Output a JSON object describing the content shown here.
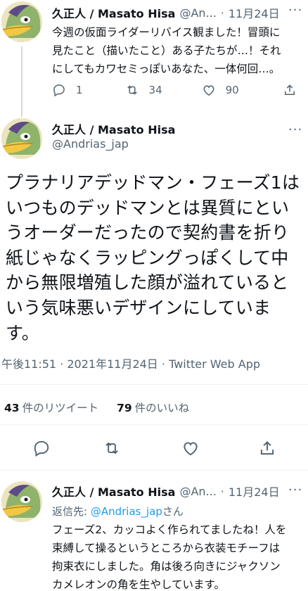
{
  "tweet1": {
    "display_name": "久正人 / Masato Hisa",
    "handle": "@An...",
    "sep": "·",
    "time": "11月24日",
    "more": "···",
    "text_lines": [
      "今週の仮面ライダーリバイス観ました！冒頭に",
      "見たこと（描いたこと）ある子たちが…！それ",
      "にしてもカワセミっぽいあなた、一体何回…。"
    ],
    "reply_count": "1",
    "retweet_count": "34",
    "like_count": "90"
  },
  "main": {
    "display_name": "久正人 / Masato Hisa",
    "handle": "@Andrias_jap",
    "more": "···",
    "text_lines": [
      "プラナリアデッドマン・フェーズ1は",
      "いつものデッドマンとは異質にとい",
      "うオーダーだったので契約書を折り",
      "紙じゃなくラッピングっぽくして中",
      "から無限増殖した顔が溢れていると",
      "いう気味悪いデザインにしていま",
      "す。"
    ],
    "meta": "午後11:51 · 2021年11月24日 · Twitter Web App",
    "retweets": "43",
    "retweets_label": "件のリツイート",
    "likes": "79",
    "likes_label": "件のいいね"
  },
  "reply": {
    "display_name": "久正人 / Masato Hisa",
    "handle": "@An...",
    "sep": "·",
    "time": "11月24日",
    "more": "···",
    "reply_prefix": "返信先: ",
    "reply_handle": "@Andrias_jap",
    "reply_suffix": "さん",
    "text_lines": [
      "フェーズ2、カッコよく作られてましたね！人を",
      "束縛して操るというところから衣装モチーフは",
      "拘束衣にしました。角は後ろ向きにジャクソン",
      "カメレオンの角を生やしています。"
    ]
  },
  "colors": {
    "text": "#0f1419",
    "secondary": "#536471",
    "link": "#1d9bf0",
    "divider": "#eff3f4"
  },
  "icons": [
    "reply-icon",
    "retweet-icon",
    "like-icon",
    "share-icon",
    "more-icon",
    "avatar"
  ]
}
